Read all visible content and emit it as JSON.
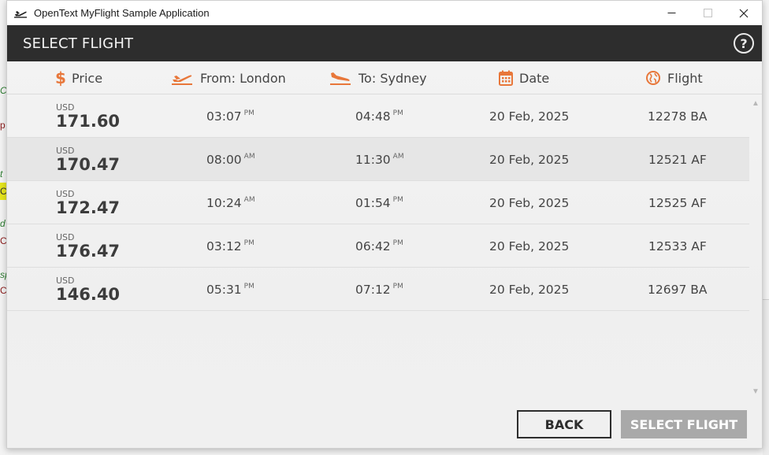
{
  "window": {
    "title": "OpenText MyFlight Sample Application"
  },
  "header": {
    "title": "SELECT FLIGHT",
    "help_label": "?"
  },
  "columns": [
    {
      "label": "Price",
      "icon": "dollar-icon"
    },
    {
      "label": "From: London",
      "icon": "plane-takeoff-icon"
    },
    {
      "label": "To: Sydney",
      "icon": "plane-landing-icon"
    },
    {
      "label": "Date",
      "icon": "calendar-icon"
    },
    {
      "label": "Flight",
      "icon": "globe-icon"
    }
  ],
  "flights": [
    {
      "currency": "USD",
      "price": "171.60",
      "depart_time": "03:07",
      "depart_ampm": "PM",
      "arrive_time": "04:48",
      "arrive_ampm": "PM",
      "date": "20 Feb, 2025",
      "flight": "12278 BA"
    },
    {
      "currency": "USD",
      "price": "170.47",
      "depart_time": "08:00",
      "depart_ampm": "AM",
      "arrive_time": "11:30",
      "arrive_ampm": "AM",
      "date": "20 Feb, 2025",
      "flight": "12521 AF"
    },
    {
      "currency": "USD",
      "price": "172.47",
      "depart_time": "10:24",
      "depart_ampm": "AM",
      "arrive_time": "01:54",
      "arrive_ampm": "PM",
      "date": "20 Feb, 2025",
      "flight": "12525 AF"
    },
    {
      "currency": "USD",
      "price": "176.47",
      "depart_time": "03:12",
      "depart_ampm": "PM",
      "arrive_time": "06:42",
      "arrive_ampm": "PM",
      "date": "20 Feb, 2025",
      "flight": "12533 AF"
    },
    {
      "currency": "USD",
      "price": "146.40",
      "depart_time": "05:31",
      "depart_ampm": "PM",
      "arrive_time": "07:12",
      "arrive_ampm": "PM",
      "date": "20 Feb, 2025",
      "flight": "12697 BA"
    }
  ],
  "buttons": {
    "back": "BACK",
    "select": "SELECT FLIGHT"
  },
  "background_fragments": [
    "C",
    "p",
    "t",
    "C",
    "d",
    "C",
    "sp",
    "C"
  ],
  "colors": {
    "accent": "#e8773a",
    "header_bg": "#2d2d2d",
    "select_disabled": "#a9a9a9"
  }
}
